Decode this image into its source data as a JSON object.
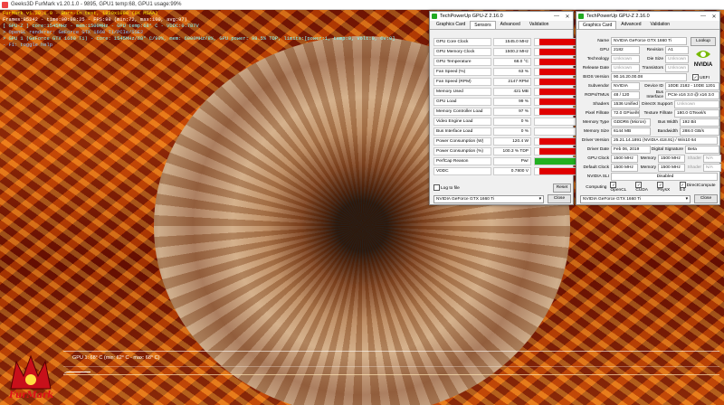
{
  "furmark": {
    "title_bar": "Geeks3D FurMark v1.20.1.0 - 9895, GPU1 temp:68, GPU1 usage:99%",
    "hud": [
      "FurMark v1.20.1.0 - Burn-in test, 1920x1080 (0X MSAA)",
      "Frames:85242 - time:00:08:25 - FPS:98 (min:72, max:100, avg:97)",
      "[ GPU-Z ] core:1545MHz - mem:1500MHz - GPU temp:68° C - VDDC:0.787V",
      "> OpenGL renderer: GeForce GTX 1660 Ti/PCIe/SSE2",
      "> GPU 1 (GeForce GTX 1660 Ti) - core: 1545MHz/68° C/99%, mem: 6000MHz/8%, GPU power: 98.5% TDP, limits:[power:1, temp:0, volt:0, OV:0]",
      "- F1: toggle help"
    ],
    "graph_label": "GPU 1: 68° C (min: 62° C - max: 68° C)",
    "logo_text": "FurMark"
  },
  "sensors_window": {
    "title": "TechPowerUp GPU-Z 2.16.0",
    "tabs": [
      "Graphics Card",
      "Sensors",
      "Advanced",
      "Validation"
    ],
    "active_tab": "Sensors",
    "rows": [
      {
        "label": "GPU Core Clock",
        "value": "1545.0 MHz",
        "fill": 0.9,
        "color": "#e00000"
      },
      {
        "label": "GPU Memory Clock",
        "value": "1500.2 MHz",
        "fill": 0.9,
        "color": "#e00000"
      },
      {
        "label": "GPU Temperature",
        "value": "68.0 °C",
        "fill": 0.9,
        "color": "#e00000"
      },
      {
        "label": "Fan Speed (%)",
        "value": "63 %",
        "fill": 0.9,
        "color": "#e00000"
      },
      {
        "label": "Fan Speed (RPM)",
        "value": "2147 RPM",
        "fill": 0.9,
        "color": "#e00000"
      },
      {
        "label": "Memory Used",
        "value": "421 MB",
        "fill": 0.9,
        "color": "#e00000"
      },
      {
        "label": "GPU Load",
        "value": "99 %",
        "fill": 0.9,
        "color": "#e00000"
      },
      {
        "label": "Memory Controller Load",
        "value": "97 %",
        "fill": 0.9,
        "color": "#e00000"
      },
      {
        "label": "Video Engine Load",
        "value": "0 %",
        "fill": 0,
        "color": "#e00000"
      },
      {
        "label": "Bus Interface Load",
        "value": "0 %",
        "fill": 0,
        "color": "#e00000"
      },
      {
        "label": "Power Consumption (W)",
        "value": "120.4 W",
        "fill": 0.9,
        "color": "#e00000"
      },
      {
        "label": "Power Consumption (%)",
        "value": "100.3 % TDP",
        "fill": 0.9,
        "color": "#e00000"
      },
      {
        "label": "PerfCap Reason",
        "value": "Pwr",
        "fill": 1,
        "color": "#22b020"
      },
      {
        "label": "VDDC",
        "value": "0.7800 V",
        "fill": 0.9,
        "color": "#e00000"
      }
    ],
    "log_label": "Log to file",
    "reset_label": "Reset",
    "gpu_select": "NVIDIA GeForce GTX 1660 Ti",
    "close_label": "Close"
  },
  "card_window": {
    "title": "TechPowerUp GPU-Z 2.16.0",
    "tabs": [
      "Graphics Card",
      "Advanced",
      "Validation"
    ],
    "active_tab": "Graphics Card",
    "name_label": "Name",
    "name_value": "NVIDIA GeForce GTX 1660 Ti",
    "lookup_label": "Lookup",
    "gpu_label": "GPU",
    "gpu_value": "2182",
    "revision_label": "Revision",
    "revision_value": "A1",
    "tech_label": "Technology",
    "tech_value": "Unknown",
    "diesize_label": "Die Size",
    "diesize_value": "Unknown",
    "release_label": "Release Date",
    "release_value": "Unknown",
    "transistors_label": "Transistors",
    "transistors_value": "Unknown",
    "bios_label": "BIOS Version",
    "bios_value": "90.16.20.00.08",
    "uefi_label": "UEFI",
    "subvendor_label": "Subvendor",
    "subvendor_value": "NVIDIA",
    "deviceid_label": "Device ID",
    "deviceid_value": "10DE 2182 - 10DE 1201",
    "rops_label": "ROPs/TMUs",
    "rops_value": "48 / 120",
    "busif_label": "Bus Interface",
    "busif_value": "PCIe x16 3.0 @ x16 3.0",
    "shaders_label": "Shaders",
    "shaders_value": "1536 Unified",
    "directx_label": "DirectX Support",
    "directx_value": "Unknown",
    "pixel_label": "Pixel Fillrate",
    "pixel_value": "72.0 GPixel/s",
    "texture_label": "Texture Fillrate",
    "texture_value": "180.0 GTexel/s",
    "memtype_label": "Memory Type",
    "memtype_value": "GDDR6 (Micron)",
    "buswidth_label": "Bus Width",
    "buswidth_value": "192 Bit",
    "memsize_label": "Memory Size",
    "memsize_value": "6144 MB",
    "bandwidth_label": "Bandwidth",
    "bandwidth_value": "288.0 GB/s",
    "driver_label": "Driver Version",
    "driver_value": "25.21.14.1891 (NVIDIA 418.91) / Win10 64",
    "driverdate_label": "Driver Date",
    "driverdate_value": "Feb 06, 2019",
    "digsig_label": "Digital Signature",
    "digsig_value": "Beta",
    "gpuclock_label": "GPU Clock",
    "gpuclock_value": "1500 MHz",
    "memclock_label": "Memory",
    "memclock_value": "1500 MHz",
    "shader_label": "Shader",
    "shader_value": "N/A",
    "defclock_label": "Default Clock",
    "defclock_value": "1500 MHz",
    "defmem_label": "Memory",
    "defmem_value": "1500 MHz",
    "defshader_label": "Shader",
    "defshader_value": "N/A",
    "sli_label": "NVIDIA SLI",
    "sli_value": "Disabled",
    "computing_label": "Computing",
    "computing": [
      "OpenCL",
      "CUDA",
      "PhysX",
      "DirectCompute 5.0"
    ],
    "gpu_select": "NVIDIA GeForce GTX 1660 Ti",
    "close_label": "Close",
    "brand": "NVIDIA"
  }
}
